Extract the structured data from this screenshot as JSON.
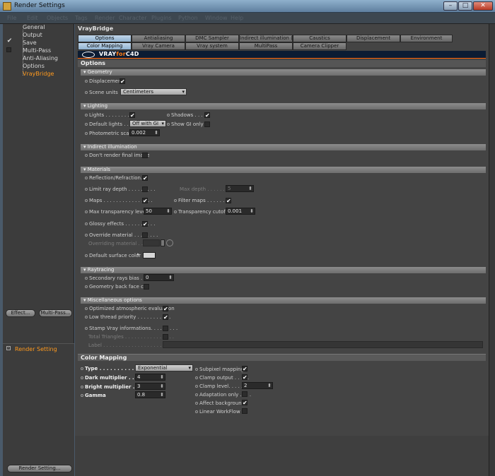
{
  "window": {
    "title": "Render Settings"
  },
  "menubar": [
    "File",
    "Edit",
    "Objects",
    "Tags",
    "Render",
    "Character",
    "Plugins",
    "Python",
    "Window",
    "Help"
  ],
  "tree": {
    "items": [
      {
        "label": "General",
        "checked": false
      },
      {
        "label": "Output",
        "checked": false
      },
      {
        "label": "Save",
        "checked": true
      },
      {
        "label": "Multi-Pass",
        "checked": false
      },
      {
        "label": "Anti-Aliasing",
        "checked": false
      },
      {
        "label": "Options",
        "checked": false
      },
      {
        "label": "VrayBridge",
        "checked": false,
        "selected": true
      }
    ],
    "effect_button": "Effect...",
    "multipass_button": "Multi-Pass...",
    "render_setting_item": "Render Setting",
    "render_setting_button": "Render Setting..."
  },
  "panel": {
    "title": "VrayBridge",
    "tabs_row1": [
      "Options",
      "Antialiasing",
      "DMC Sampler",
      "Indirect illumination (GI)",
      "Caustics",
      "Displacement",
      "Environment"
    ],
    "tabs_row2": [
      "Color Mapping",
      "Vray Camera",
      "Vray system",
      "MultiPass",
      "Camera Clipper"
    ],
    "logo_part1": "VRAY",
    "logo_part2": "for",
    "logo_part3": "C4D",
    "options_header": "Options"
  },
  "geometry": {
    "header": "Geometry",
    "displacement_label": "Displacement",
    "scene_units_label": "Scene units",
    "scene_units_value": "Centimeters"
  },
  "lighting": {
    "header": "Lighting",
    "lights_label": "Lights . . . . . . . . . .",
    "shadows_label": "Shadows . . . .",
    "default_lights_label": "Default lights . . . .",
    "default_lights_value": "Off with GI",
    "show_gi_only_label": "Show GI only",
    "photometric_label": "Photometric scale",
    "photometric_value": "0.002"
  },
  "indirect": {
    "header": "Indirect illumination",
    "dont_render_label": "Don't render final image"
  },
  "materials": {
    "header": "Materials",
    "reflection_label": "Reflection/Refraction.",
    "limit_ray_label": "Limit ray depth . . . . . . . . .",
    "max_depth_label": "Max depth . . . . . .",
    "max_depth_value": "5",
    "maps_label": "Maps . . . . . . . . . . . . . . . .",
    "filter_maps_label": "Filter maps . . . . . . .",
    "max_transp_label": "Max transparency levels",
    "max_transp_value": "50",
    "transp_cutoff_label": "Transparency cutoff",
    "transp_cutoff_value": "0.001",
    "glossy_label": "Glossy effects . . . . . . . . . .",
    "override_label": "Override material . . . . . . . .",
    "overriding_label": "Overriding material . . . . .",
    "default_surface_label": "Default surface color"
  },
  "raytracing": {
    "header": "Raytracing",
    "secondary_label": "Secondary rays bias . . . .",
    "secondary_value": "0",
    "backface_label": "Geometry back face cull"
  },
  "misc": {
    "header": "Miscellaneous options",
    "atmos_label": "Optimized atmospheric evaluation",
    "low_thread_label": "Low thread priority . . . . . . . . . . .",
    "stamp_label": "Stamp Vray informations. . . . . . . . .",
    "triangles_label": "Total Triangles . . . . . . . . . . . . . . . .",
    "label_label": "Label . . . . . . . . . . . . . . . . . . . . . . . ."
  },
  "color_mapping": {
    "header": "Color Mapping",
    "type_label": "Type . . . . . . . . . . . .",
    "type_value": "Exponential",
    "dark_label": "Dark multiplier . . .",
    "dark_value": "4",
    "bright_label": "Bright multiplier . . .",
    "bright_value": "3",
    "gamma_label": "Gamma",
    "gamma_value": "0.8",
    "subpixel_label": "Subpixel mapping",
    "clamp_output_label": "Clamp output . . . . .",
    "clamp_level_label": "Clamp level. . . . . . .",
    "clamp_level_value": "2",
    "adaptation_label": "Adaptation only . . . .",
    "affect_bg_label": "Affect background",
    "linear_label": "Linear WorkFlow"
  },
  "checks": {
    "displacement": true,
    "lights": true,
    "shadows": true,
    "show_gi_only": false,
    "dont_render": false,
    "reflection": true,
    "limit_ray": false,
    "maps": true,
    "filter_maps": true,
    "glossy": true,
    "override": false,
    "backface": false,
    "atmos": true,
    "low_thread": true,
    "stamp": false,
    "triangles": false,
    "subpixel": true,
    "clamp_output": true,
    "adaptation": false,
    "affect_bg": true,
    "linear": false
  },
  "colors": {
    "accent": "#ff9a1e",
    "active_tab": "#a8c6e0",
    "panel": "#444444",
    "logo_bg": "#0c1c33"
  }
}
